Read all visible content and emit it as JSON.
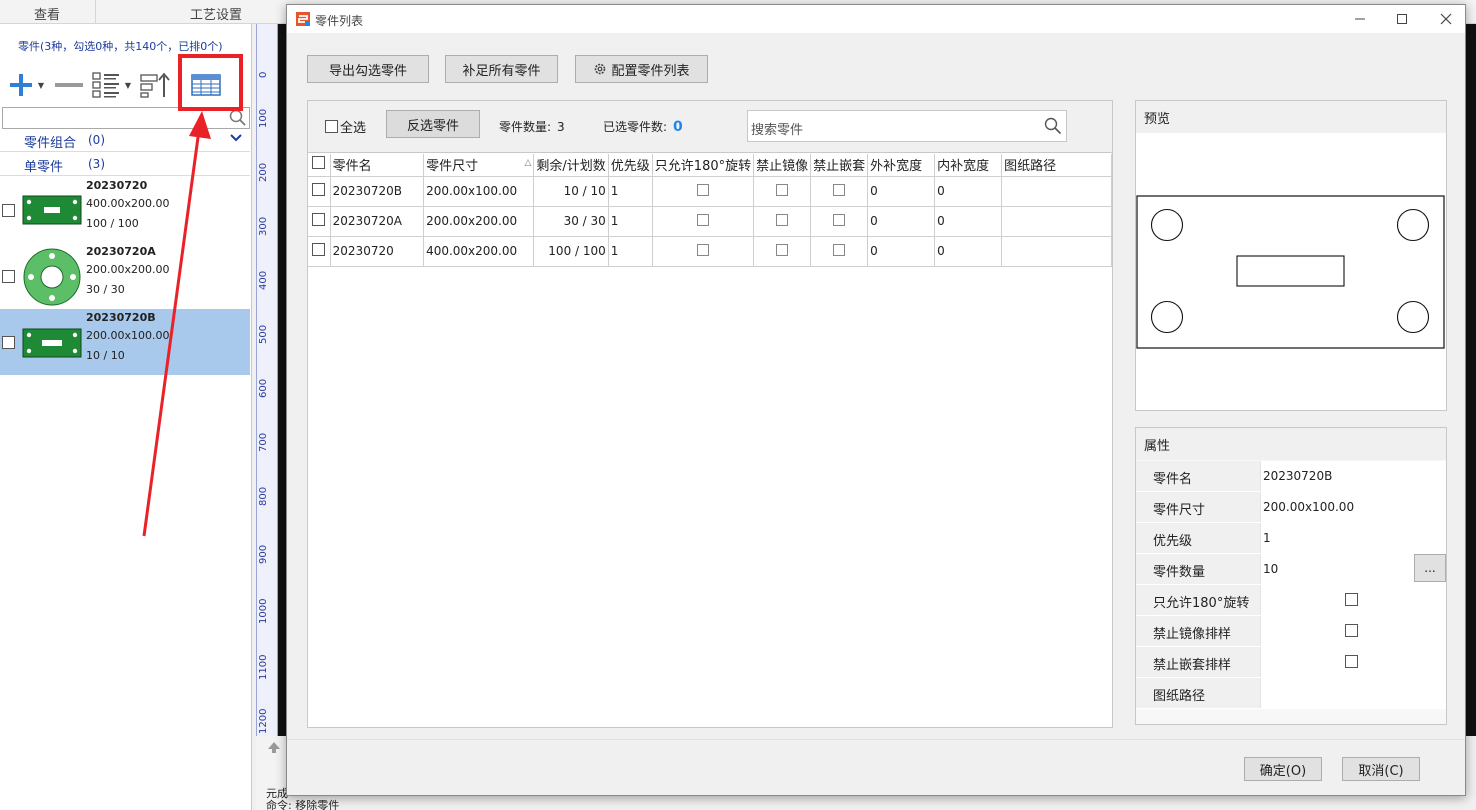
{
  "menubar": {
    "items": [
      "查看",
      "工艺设置"
    ]
  },
  "left_panel": {
    "summary": "零件(3种，勾选0种，共140个，已排0个)",
    "groups": [
      {
        "label": "零件组合",
        "count": "(0)"
      },
      {
        "label": "单零件",
        "count": "(3)"
      }
    ],
    "parts": [
      {
        "name": "20230720",
        "size": "400.00x200.00",
        "qty": "100 / 100"
      },
      {
        "name": "20230720A",
        "size": "200.00x200.00",
        "qty": "30 / 30"
      },
      {
        "name": "20230720B",
        "size": "200.00x100.00",
        "qty": "10 / 10"
      }
    ],
    "colors": {
      "part_fill": "#5cbf67",
      "part_fill_dark": "#1e8a35",
      "selected_bg": "#a8c8ec",
      "highlight": "#ea2228"
    }
  },
  "ruler": {
    "labels": [
      "0",
      "100",
      "200",
      "300",
      "400",
      "500",
      "600",
      "700",
      "800",
      "900",
      "1000",
      "1100",
      "1200"
    ]
  },
  "command_line": {
    "line1": "元成",
    "line2": "命令: 移除零件"
  },
  "dialog": {
    "title": "零件列表",
    "toolbar": {
      "export": "导出勾选零件",
      "fill": "补足所有零件",
      "config": "配置零件列表"
    },
    "list": {
      "select_all": "全选",
      "invert": "反选零件",
      "count_label": "零件数量:",
      "count_value": "3",
      "selected_label": "已选零件数:",
      "selected_value": "0",
      "search_placeholder": "搜索零件",
      "columns": [
        "零件名",
        "零件尺寸",
        "剩余/计划数",
        "优先级",
        "只允许180°旋转",
        "禁止镜像",
        "禁止嵌套",
        "外补宽度",
        "内补宽度",
        "图纸路径"
      ],
      "rows": [
        {
          "name": "20230720B",
          "size": "200.00x100.00",
          "remain": "10 / 10",
          "priority": "1",
          "outer": "0",
          "inner": "0"
        },
        {
          "name": "20230720A",
          "size": "200.00x200.00",
          "remain": "30 / 30",
          "priority": "1",
          "outer": "0",
          "inner": "0"
        },
        {
          "name": "20230720",
          "size": "400.00x200.00",
          "remain": "100 / 100",
          "priority": "1",
          "outer": "0",
          "inner": "0"
        }
      ]
    },
    "preview": {
      "title": "预览"
    },
    "properties": {
      "title": "属性",
      "rows": [
        {
          "key": "零件名",
          "value": "20230720B"
        },
        {
          "key": "零件尺寸",
          "value": "200.00x100.00"
        },
        {
          "key": "优先级",
          "value": "1"
        },
        {
          "key": "零件数量",
          "value": "10",
          "button": "..."
        },
        {
          "key": "只允许180°旋转"
        },
        {
          "key": "禁止镜像排样"
        },
        {
          "key": "禁止嵌套排样"
        },
        {
          "key": "图纸路径",
          "value": ""
        }
      ]
    },
    "ok": "确定(O)",
    "cancel": "取消(C)"
  }
}
